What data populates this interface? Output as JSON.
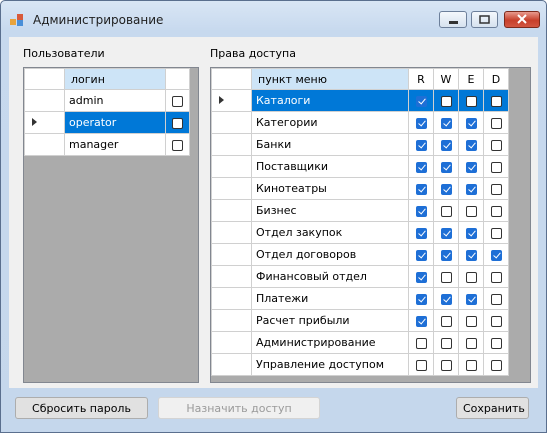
{
  "window": {
    "title": "Администрирование"
  },
  "users": {
    "label": "Пользователи",
    "column": "логин",
    "rows": [
      {
        "login": "admin",
        "checked": false,
        "selected": false
      },
      {
        "login": "operator",
        "checked": false,
        "selected": true
      },
      {
        "login": "manager",
        "checked": false,
        "selected": false
      }
    ]
  },
  "access": {
    "label": "Права доступа",
    "column": "пункт меню",
    "flags": [
      "R",
      "W",
      "E",
      "D"
    ],
    "rows": [
      {
        "name": "Каталоги",
        "selected": true,
        "r": true,
        "w": false,
        "e": false,
        "d": false
      },
      {
        "name": "Категории",
        "r": true,
        "w": true,
        "e": true,
        "d": false
      },
      {
        "name": "Банки",
        "r": true,
        "w": true,
        "e": true,
        "d": false
      },
      {
        "name": "Поставщики",
        "r": true,
        "w": true,
        "e": true,
        "d": false
      },
      {
        "name": "Кинотеатры",
        "r": true,
        "w": true,
        "e": true,
        "d": false
      },
      {
        "name": "Бизнес",
        "r": true,
        "w": false,
        "e": false,
        "d": false
      },
      {
        "name": "Отдел закупок",
        "r": true,
        "w": true,
        "e": true,
        "d": false
      },
      {
        "name": "Отдел договоров",
        "r": true,
        "w": true,
        "e": true,
        "d": true
      },
      {
        "name": "Финансовый отдел",
        "r": true,
        "w": false,
        "e": false,
        "d": false
      },
      {
        "name": "Платежи",
        "r": true,
        "w": true,
        "e": true,
        "d": false
      },
      {
        "name": "Расчет прибыли",
        "r": true,
        "w": false,
        "e": false,
        "d": false
      },
      {
        "name": "Администрирование",
        "r": false,
        "w": false,
        "e": false,
        "d": false
      },
      {
        "name": "Управление доступом",
        "r": false,
        "w": false,
        "e": false,
        "d": false
      }
    ]
  },
  "buttons": {
    "reset": "Сбросить пароль",
    "assign": "Назначить доступ",
    "save": "Сохранить"
  }
}
